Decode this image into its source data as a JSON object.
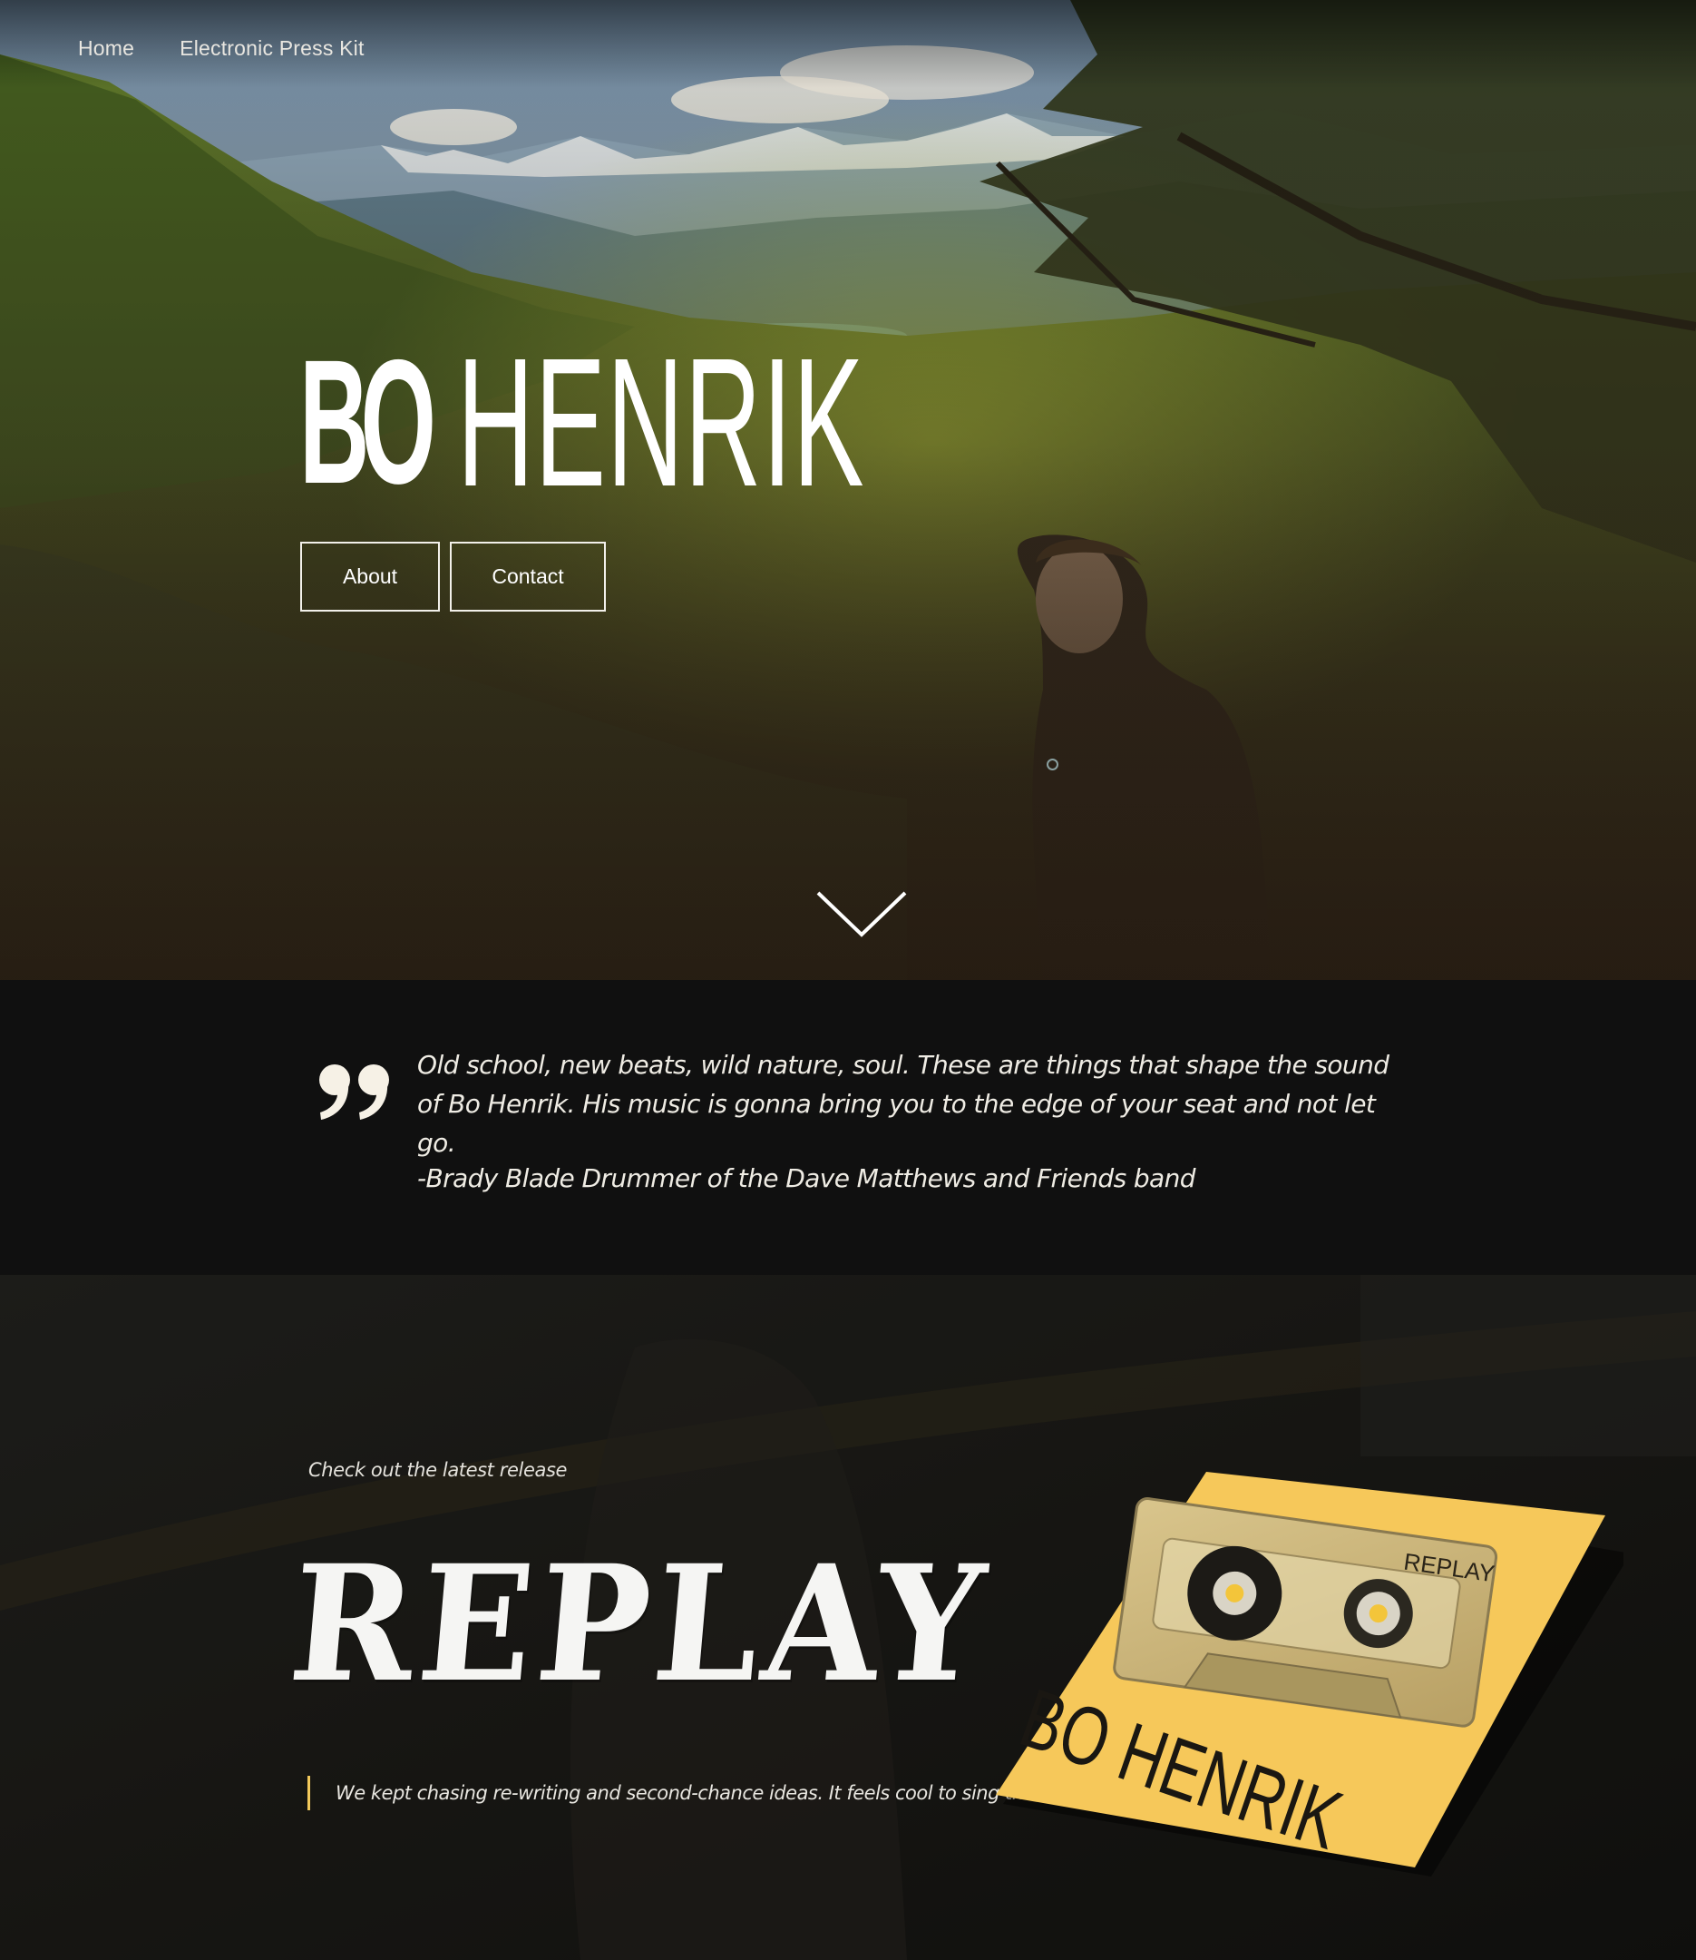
{
  "nav": {
    "items": [
      {
        "label": "Home"
      },
      {
        "label": "Electronic Press Kit"
      }
    ]
  },
  "hero": {
    "logo_first": "BO",
    "logo_last": "HENRIK",
    "buttons": [
      {
        "label": "About"
      },
      {
        "label": "Contact"
      }
    ]
  },
  "quote": {
    "text": "Old school, new beats, wild nature, soul. These are things that shape the sound of Bo Henrik. His music is gonna bring you to the edge of your seat and not let go.",
    "attribution": "-Brady Blade Drummer of the Dave Matthews and Friends band"
  },
  "release": {
    "kicker": "Check out the latest release",
    "title": "REPLAY",
    "note": "We kept chasing re-writing and second-chance ideas. It feels cool to sing this one.",
    "album": {
      "artist": "BO HENRIK",
      "tape_label": "REPLAY"
    }
  },
  "colors": {
    "accent": "#f2c95b",
    "album_yellow": "#f6c85a",
    "quote_bg": "#101010"
  }
}
